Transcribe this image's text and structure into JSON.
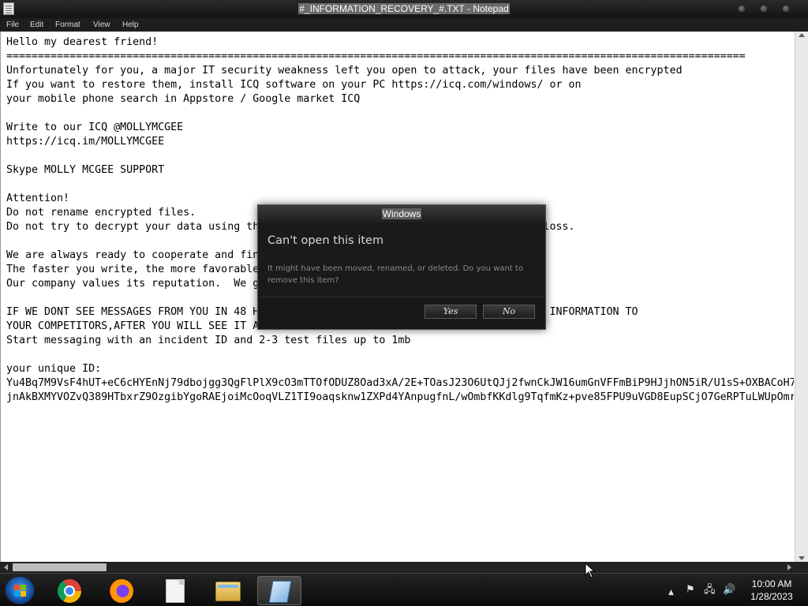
{
  "window": {
    "title": "#_INFORMATION_RECOVERY_#.TXT - Notepad"
  },
  "menu": [
    "File",
    "Edit",
    "Format",
    "View",
    "Help"
  ],
  "document": {
    "lines": [
      "Hello my dearest friend!",
      "=====================================================================================================================",
      "Unfortunately for you, a major IT security weakness left you open to attack, your files have been encrypted",
      "If you want to restore them, install ICQ software on your PC https://icq.com/windows/ or on",
      "your mobile phone search in Appstore / Google market ICQ",
      "",
      "Write to our ICQ @MOLLYMCGEE",
      "https://icq.im/MOLLYMCGEE",
      "",
      "Skype MOLLY MCGEE SUPPORT",
      "",
      "Attention!",
      "Do not rename encrypted files.",
      "Do not try to decrypt your data using th                                          ta loss.",
      "",
      "We are always ready to cooperate and fin",
      "The faster you write, the more favorable",
      "Our company values its reputation.  We g",
      "",
      "IF WE DONT SEE MESSAGES FROM YOU IN 48 H                                          ANT INFORMATION TO",
      "YOUR COMPETITORS,AFTER YOU WILL SEE IT A",
      "Start messaging with an incident ID and 2-3 test files up to 1mb",
      "",
      "your unique ID:",
      "Yu4Bq7M9VsF4hUT+eC6cHYEnNj79dbojgg3QgFlPlX9cO3mTTOfODUZ8Oad3xA/2E+TOasJ23O6UtQJj2fwnCkJW16umGnVFFmBiP9HJjhON5iR/U1sS+OXBACoH7",
      "jnAkBXMYVOZvQ389HTbxrZ9OzgibYgoRAEjoiMcOoqVLZ1TI9oaqsknw1ZXPd4YAnpugfnL/wOmbfKKdlg9TqfmKz+pve85FPU9uVGD8EupSCjO7GeRPTuLWUpOmr"
    ]
  },
  "dialog": {
    "title": "Windows",
    "heading": "Can't open this item",
    "message": "It might have been moved, renamed, or deleted. Do you want to remove this item?",
    "yes_label": "Yes",
    "no_label": "No"
  },
  "taskbar": {
    "apps": [
      "chrome-icon",
      "firefox-icon",
      "file-icon",
      "file-explorer-icon",
      "notepad-icon"
    ],
    "tray": {
      "show_hidden": "▲",
      "flag": "⚑",
      "network": "🖧",
      "volume": "🔊"
    },
    "time": "10:00 AM",
    "date": "1/28/2023"
  }
}
